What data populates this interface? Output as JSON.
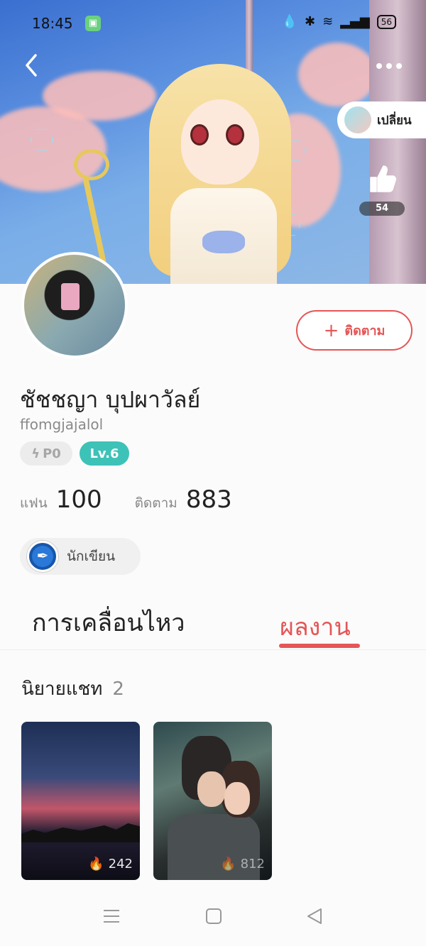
{
  "status_bar": {
    "time": "18:45",
    "battery": "56"
  },
  "header": {
    "change_label": "เปลี่ยน",
    "like_count": "54"
  },
  "profile": {
    "follow_label": "ติดตาม",
    "name": "ชัชชญา บุปผาวัลย์",
    "username": "ffomgjajalol",
    "badge_power": "P0",
    "badge_level": "Lv.6",
    "fans_label": "แฟน",
    "fans_value": "100",
    "following_label": "ติดตาม",
    "following_value": "883",
    "role": "นักเขียน"
  },
  "tabs": {
    "moves": "การเคลื่อนไหว",
    "works": "ผลงาน",
    "active": "works"
  },
  "section": {
    "title": "นิยายแชท",
    "count": "2"
  },
  "cards": [
    {
      "heat": "242"
    },
    {
      "heat": "812"
    }
  ],
  "colors": {
    "accent": "#e55656",
    "level_badge": "#3dc2b8"
  }
}
